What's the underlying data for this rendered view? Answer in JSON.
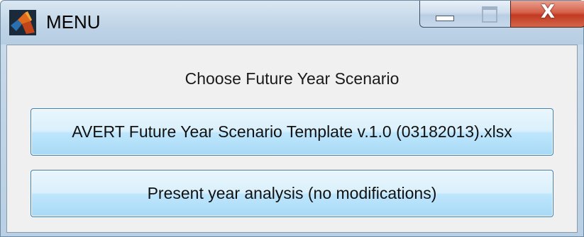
{
  "window": {
    "title": "MENU",
    "icon": "matlab-logo-icon",
    "controls": {
      "minimize": "minimize-icon",
      "maximize": "maximize-icon",
      "close": "close-icon",
      "close_label": "X"
    }
  },
  "dialog": {
    "heading": "Choose Future Year Scenario",
    "options": [
      {
        "label": "AVERT Future Year Scenario Template v.1.0 (03182013).xlsx"
      },
      {
        "label": "Present year analysis (no modifications)"
      }
    ]
  },
  "colors": {
    "button_border": "#3c7fb1",
    "button_fill": "#bee6fd",
    "close_red": "#c23a22",
    "client_bg": "#f0f0f0"
  }
}
